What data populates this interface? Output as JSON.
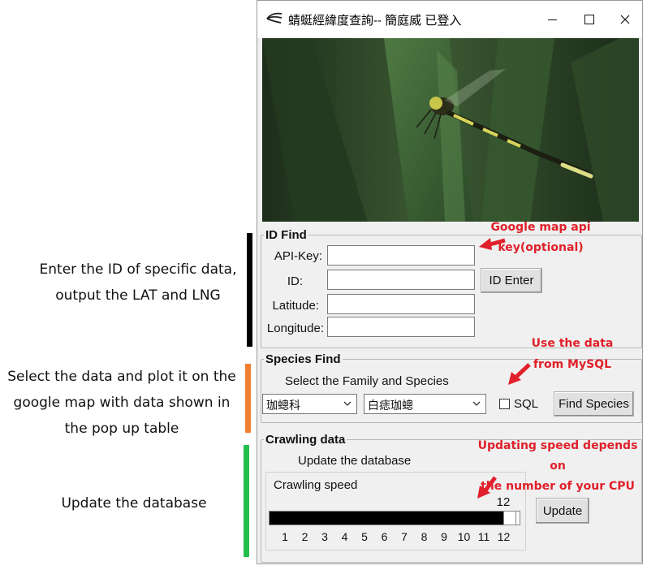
{
  "annotations": {
    "id_note": [
      "Enter the ID of specific data,",
      "output the LAT and LNG"
    ],
    "species_note": [
      "Select the data and plot it on the",
      "google map with data shown in",
      "the pop up table"
    ],
    "crawl_note": "Update the database",
    "api_callout": [
      "Google map api",
      "key(optional)"
    ],
    "sql_callout": [
      "Use the data",
      "from MySQL"
    ],
    "speed_callout": [
      "Updating speed depends on",
      "the number of your CPU"
    ],
    "bar_colors": {
      "id": "#000000",
      "species": "#f08030",
      "crawl": "#22c04a"
    }
  },
  "window": {
    "title": "蜻蜓經緯度查詢-- 簡庭威 已登入",
    "minimize_icon": "minimize-icon",
    "maximize_icon": "maximize-icon",
    "close_icon": "close-icon"
  },
  "id_find": {
    "legend": "ID Find",
    "api_key_label": "API-Key:",
    "id_label": "ID:",
    "latitude_label": "Latitude:",
    "longitude_label": "Longitude:",
    "api_key_value": "",
    "id_value": "",
    "latitude_value": "",
    "longitude_value": "",
    "enter_button": "ID Enter"
  },
  "species_find": {
    "legend": "Species Find",
    "instruction": "Select the Family and Species",
    "family_selected": "珈蟌科",
    "species_selected": "白痣珈蟌",
    "sql_label": "SQL",
    "sql_checked": false,
    "find_button": "Find Species"
  },
  "crawling": {
    "legend": "Crawling data",
    "instruction": "Update the database",
    "speed_label": "Crawling speed",
    "speed_value": "12",
    "speed_max": 12,
    "ticks": [
      "1",
      "2",
      "3",
      "4",
      "5",
      "6",
      "7",
      "8",
      "9",
      "10",
      "11",
      "12"
    ],
    "update_button": "Update"
  }
}
